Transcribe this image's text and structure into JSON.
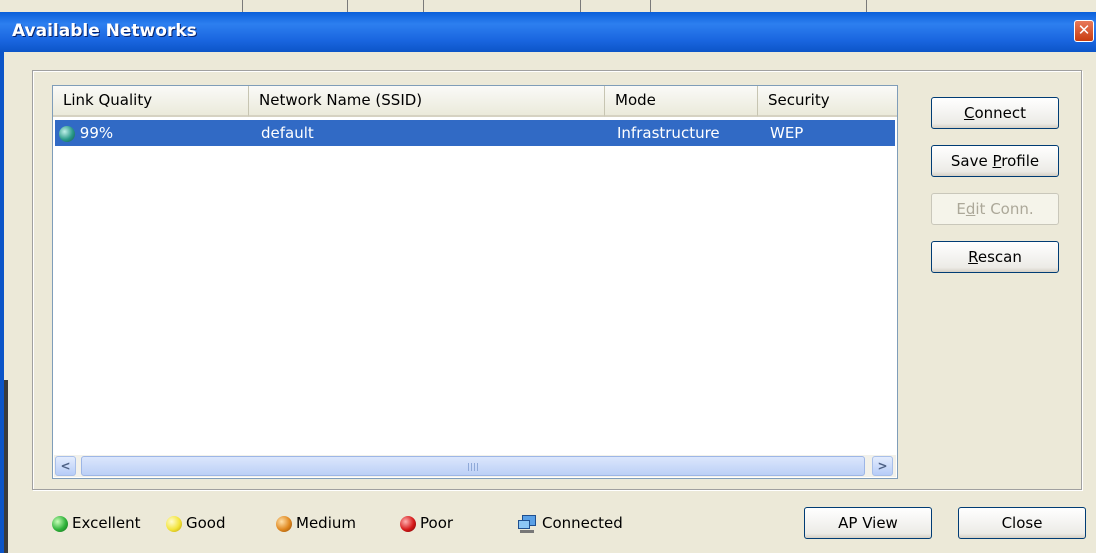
{
  "window": {
    "title": "Available Networks",
    "close_glyph": "✕"
  },
  "list": {
    "columns": [
      "Link Quality",
      "Network Name (SSID)",
      "Mode",
      "Security"
    ],
    "rows": [
      {
        "link_quality": "99%",
        "ssid": "default",
        "mode": "Infrastructure",
        "security": "WEP",
        "quality_icon": "teal-signal-dot",
        "selected": true
      }
    ],
    "scroll_left_glyph": "<",
    "scroll_right_glyph": ">"
  },
  "buttons": {
    "connect": {
      "pre": "",
      "key": "C",
      "post": "onnect"
    },
    "save_profile": {
      "pre": "Save ",
      "key": "P",
      "post": "rofile"
    },
    "edit_conn": {
      "pre": "E",
      "key": "d",
      "post": "it Conn."
    },
    "rescan": {
      "pre": "",
      "key": "R",
      "post": "escan"
    },
    "ap_view": "AP View",
    "close": "Close"
  },
  "legend": {
    "excellent": "Excellent",
    "good": "Good",
    "medium": "Medium",
    "poor": "Poor",
    "connected": "Connected"
  },
  "colors": {
    "selection": "#316ac5",
    "titlebar": "#1a66e0",
    "excellent": "#2fb33a",
    "good": "#f3e43a",
    "medium": "#e0881f",
    "poor": "#d61a1a"
  }
}
